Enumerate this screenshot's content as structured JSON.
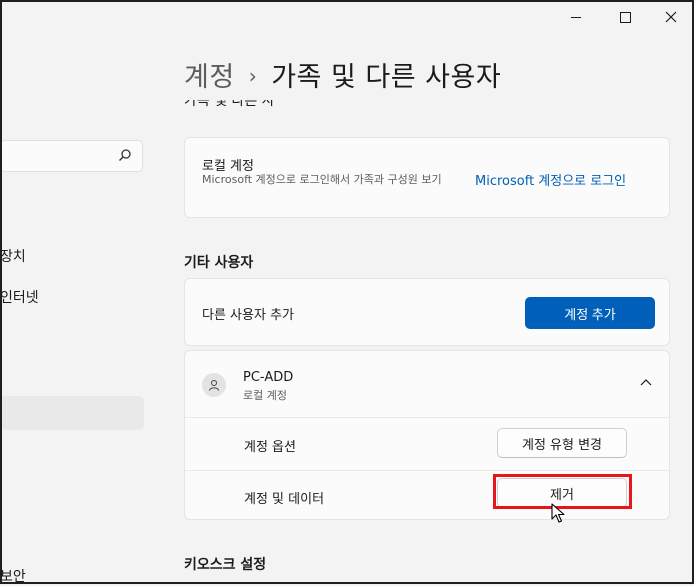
{
  "window": {
    "minimize_label": "minimize",
    "maximize_label": "maximize",
    "close_label": "close"
  },
  "breadcrumb": {
    "parent": "계정",
    "separator": "›",
    "current": "가족 및 다른 사용자"
  },
  "sidebar": {
    "search_placeholder": "",
    "items": [
      {
        "label": "장치"
      },
      {
        "label": "인터넷"
      },
      {
        "label": "보안"
      }
    ]
  },
  "cut_text": "가족 및 다른 사",
  "local_account": {
    "title": "로컬 계정",
    "description": "Microsoft 계정으로 로그인해서 가족과 구성원 보기",
    "link": "Microsoft 계정으로 로그인"
  },
  "other_users": {
    "section_title": "기타 사용자",
    "add_label": "다른 사용자 추가",
    "add_button": "계정 추가",
    "user": {
      "name": "PC-ADD",
      "type": "로컬 계정",
      "options_label": "계정 옵션",
      "change_type_button": "계정 유형 변경",
      "data_label": "계정 및 데이터",
      "remove_button": "제거"
    }
  },
  "kiosk": {
    "section_title": "키오스크 설정"
  },
  "colors": {
    "accent": "#005fb8",
    "highlight": "#e8161c",
    "background": "#f3f3f3"
  }
}
